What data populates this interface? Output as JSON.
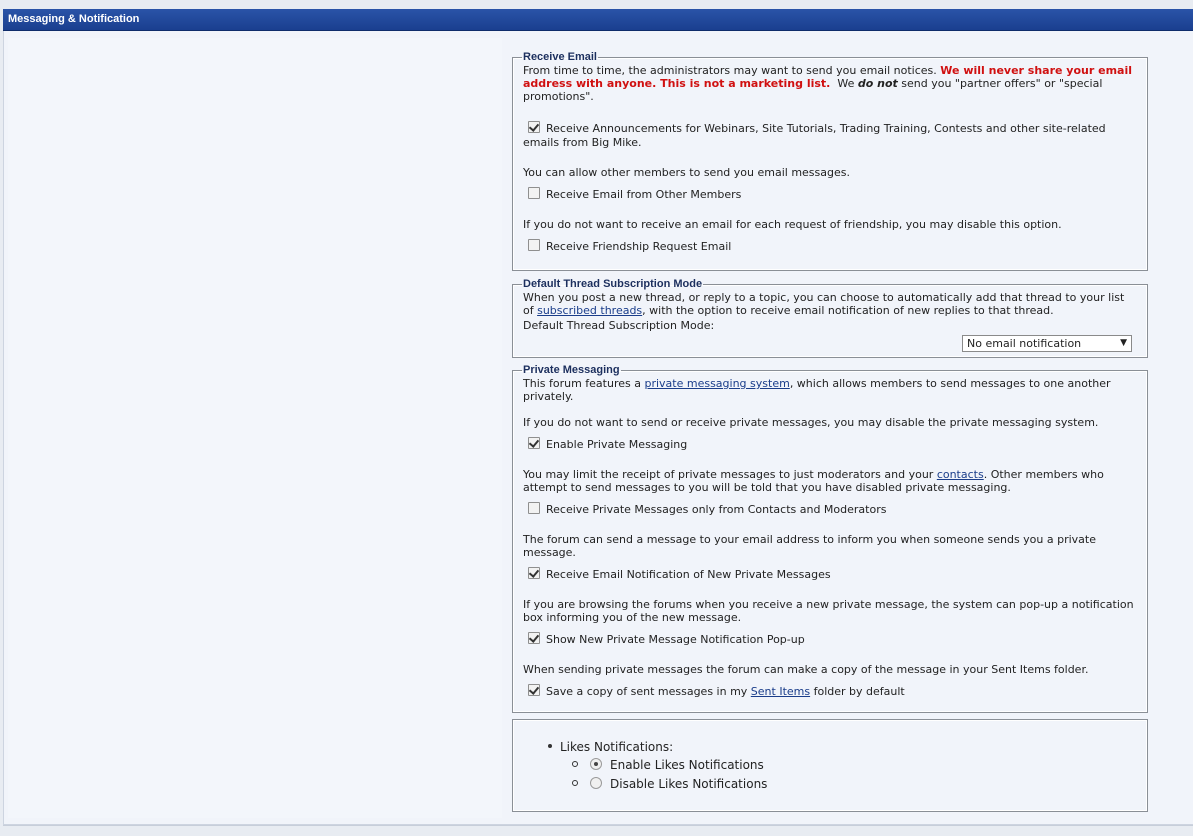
{
  "section_title": "Messaging & Notification",
  "receive_email": {
    "legend": "Receive Email",
    "intro_1": "From time to time, the administrators may want to send you email notices. ",
    "intro_red": "We will never share your email address with anyone. This is not a marketing list.",
    "intro_2": "  We ",
    "intro_ital": "do not",
    "intro_3": " send you \"partner offers\" or \"special promotions\".",
    "announcements_label": "Receive Announcements for Webinars, Site Tutorials, Trading Training, Contests and other site-related emails from Big Mike.",
    "announcements_checked": true,
    "members_text": "You can allow other members to send you email messages.",
    "members_label": "Receive Email from Other Members",
    "members_checked": false,
    "friendship_text": "If you do not want to receive an email for each request of friendship, you may disable this option.",
    "friendship_label": "Receive Friendship Request Email",
    "friendship_checked": false
  },
  "thread_sub": {
    "legend": "Default Thread Subscription Mode",
    "text_1": "When you post a new thread, or reply to a topic, you can choose to automatically add that thread to your list of ",
    "link": "subscribed threads",
    "text_2": ", with the option to receive email notification of new replies to that thread.",
    "mode_label": "Default Thread Subscription Mode:",
    "mode_value": "No email notification"
  },
  "private_messaging": {
    "legend": "Private Messaging",
    "intro_1": "This forum features a ",
    "intro_link": "private messaging system",
    "intro_2": ", which allows members to send messages to one another privately.",
    "disable_text": "If you do not want to send or receive private messages, you may disable the private messaging system.",
    "enable_label": "Enable Private Messaging",
    "enable_checked": true,
    "limit_text_1": "You may limit the receipt of private messages to just moderators and your ",
    "limit_link": "contacts",
    "limit_text_2": ". Other members who attempt to send messages to you will be told that you have disabled private messaging.",
    "contacts_label": "Receive Private Messages only from Contacts and Moderators",
    "contacts_checked": false,
    "email_text": "The forum can send a message to your email address to inform you when someone sends you a private message.",
    "email_label": "Receive Email Notification of New Private Messages",
    "email_checked": true,
    "popup_text": "If you are browsing the forums when you receive a new private message, the system can pop-up a notification box informing you of the new message.",
    "popup_label": "Show New Private Message Notification Pop-up",
    "popup_checked": true,
    "copy_text": "When sending private messages the forum can make a copy of the message in your Sent Items folder.",
    "copy_label_1": "Save a copy of sent messages in my ",
    "copy_link": "Sent Items",
    "copy_label_2": " folder by default",
    "copy_checked": true
  },
  "likes": {
    "heading": "Likes Notifications:",
    "enable_label": "Enable Likes Notifications",
    "disable_label": "Disable Likes Notifications",
    "selected": "enable"
  }
}
